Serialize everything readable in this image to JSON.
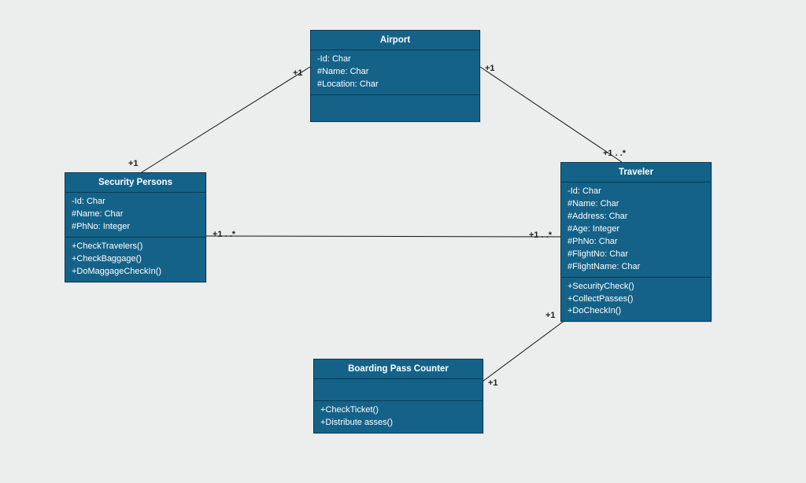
{
  "colors": {
    "box_fill": "#156288",
    "box_border": "#0a3a52",
    "bg": "#eceded"
  },
  "classes": {
    "airport": {
      "title": "Airport",
      "attrs": [
        "-Id: Char",
        "#Name: Char",
        "#Location: Char"
      ],
      "methods": []
    },
    "security": {
      "title": "Security Persons",
      "attrs": [
        "-Id: Char",
        "#Name: Char",
        "#PhNo: Integer"
      ],
      "methods": [
        "+CheckTravelers()",
        "+CheckBaggage()",
        "+DoMaggageCheckIn()"
      ]
    },
    "traveler": {
      "title": "Traveler",
      "attrs": [
        "-Id: Char",
        "#Name: Char",
        "#Address: Char",
        "#Age: Integer",
        "#PhNo: Char",
        "#FlightNo: Char",
        "#FlightName: Char"
      ],
      "methods": [
        "+SecurityCheck()",
        "+CollectPasses()",
        "+DoCheckIn()"
      ]
    },
    "boarding": {
      "title": "Boarding Pass Counter",
      "attrs": [],
      "methods": [
        "+CheckTicket()",
        "+Distribute asses()"
      ]
    }
  },
  "multiplicities": {
    "airport_left": "+1",
    "airport_right": "+1",
    "security_top": "+1",
    "security_right": "+1 . .*",
    "traveler_top": "+1 . .*",
    "traveler_left_mid": "+1 . .*",
    "traveler_left_low": "+1",
    "boarding_right": "+1"
  }
}
